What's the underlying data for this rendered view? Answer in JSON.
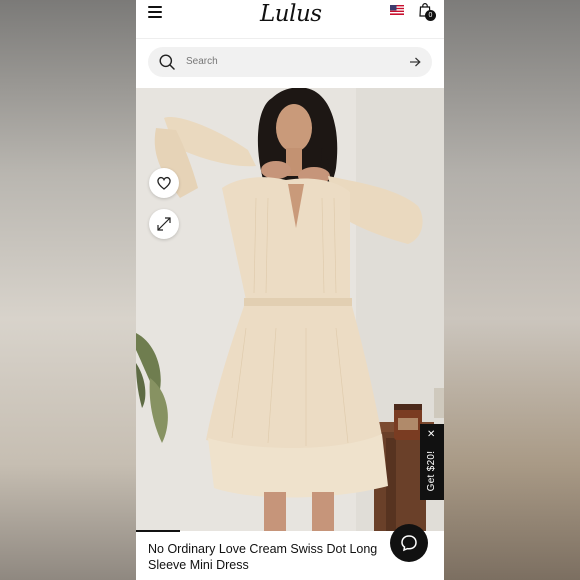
{
  "header": {
    "brand": "Lulus",
    "menu_icon": "hamburger-menu-icon",
    "flag_icon": "us-flag-icon",
    "cart_icon": "shopping-bag-icon",
    "cart_count": "0"
  },
  "search": {
    "placeholder": "Search",
    "icon": "search-icon",
    "submit_icon": "arrow-right-icon"
  },
  "gallery": {
    "favorite_icon": "heart-icon",
    "expand_icon": "expand-arrows-icon"
  },
  "promo": {
    "label": "Get $20!",
    "close_icon": "close-icon"
  },
  "product": {
    "title": "No Ordinary Love Cream Swiss Dot Long Sleeve Mini Dress"
  },
  "chat": {
    "icon": "chat-bubble-icon"
  },
  "colors": {
    "text": "#111111",
    "search_bg": "#f1f1f1",
    "dress": "#ecdcc4",
    "background": "#e9e6e1"
  }
}
